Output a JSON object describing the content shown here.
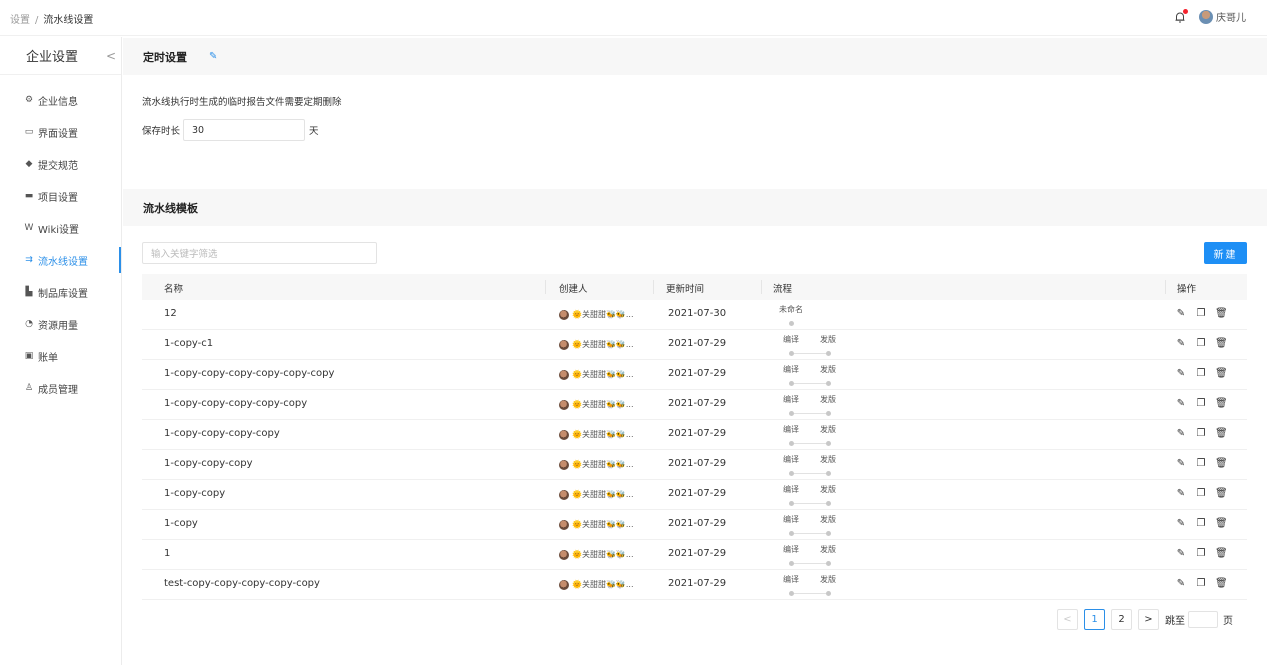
{
  "breadcrumb": {
    "parent": "设置",
    "separator": "/",
    "current": "流水线设置"
  },
  "header": {
    "user_name": "庆哥儿"
  },
  "sidebar": {
    "title": "企业设置",
    "collapse_glyph": "<",
    "items": [
      {
        "label": "企业信息",
        "icon": "⚙"
      },
      {
        "label": "界面设置",
        "icon": "▭"
      },
      {
        "label": "提交规范",
        "icon": "◆"
      },
      {
        "label": "项目设置",
        "icon": "▬"
      },
      {
        "label": "Wiki设置",
        "icon": "W"
      },
      {
        "label": "流水线设置",
        "icon": "⇉"
      },
      {
        "label": "制品库设置",
        "icon": "▙"
      },
      {
        "label": "资源用量",
        "icon": "◔"
      },
      {
        "label": "账单",
        "icon": "▣"
      },
      {
        "label": "成员管理",
        "icon": "♙"
      }
    ],
    "active_index": 5
  },
  "timer_section": {
    "title": "定时设置",
    "description": "流水线执行时生成的临时报告文件需要定期删除",
    "keep_label": "保存时长",
    "keep_value": "30",
    "keep_unit": "天"
  },
  "template_section": {
    "title": "流水线模板",
    "search_placeholder": "输入关键字筛选",
    "new_button": "新建"
  },
  "table": {
    "headers": {
      "name": "名称",
      "creator": "创建人",
      "updated": "更新时间",
      "flow": "流程",
      "ops": "操作"
    },
    "creator_display": "🌞关甜甜🐝🐝...",
    "rows": [
      {
        "name": "12",
        "date": "2021-07-30",
        "stages": [
          "未命名"
        ]
      },
      {
        "name": "1-copy-c1",
        "date": "2021-07-29",
        "stages": [
          "编译",
          "发版"
        ]
      },
      {
        "name": "1-copy-copy-copy-copy-copy-copy",
        "date": "2021-07-29",
        "stages": [
          "编译",
          "发版"
        ]
      },
      {
        "name": "1-copy-copy-copy-copy-copy",
        "date": "2021-07-29",
        "stages": [
          "编译",
          "发版"
        ]
      },
      {
        "name": "1-copy-copy-copy-copy",
        "date": "2021-07-29",
        "stages": [
          "编译",
          "发版"
        ]
      },
      {
        "name": "1-copy-copy-copy",
        "date": "2021-07-29",
        "stages": [
          "编译",
          "发版"
        ]
      },
      {
        "name": "1-copy-copy",
        "date": "2021-07-29",
        "stages": [
          "编译",
          "发版"
        ]
      },
      {
        "name": "1-copy",
        "date": "2021-07-29",
        "stages": [
          "编译",
          "发版"
        ]
      },
      {
        "name": "1",
        "date": "2021-07-29",
        "stages": [
          "编译",
          "发版"
        ]
      },
      {
        "name": "test-copy-copy-copy-copy-copy",
        "date": "2021-07-29",
        "stages": [
          "编译",
          "发版"
        ]
      }
    ]
  },
  "pagination": {
    "prev": "<",
    "pages": [
      "1",
      "2"
    ],
    "current": "1",
    "next": ">",
    "jump_label": "跳至",
    "page_unit": "页"
  },
  "colors": {
    "accent": "#1e8ff5",
    "notification_dot": "#f5222d"
  }
}
